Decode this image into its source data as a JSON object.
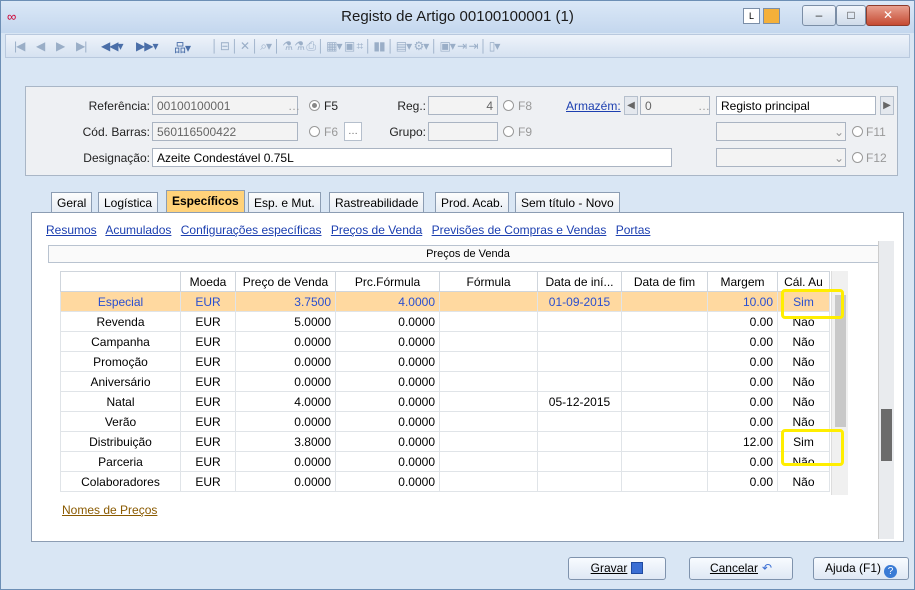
{
  "window": {
    "title": "Registo de Artigo 00100100001 (1)"
  },
  "header": {
    "referencia_label": "Referência:",
    "referencia_value": "00100100001",
    "f5": "F5",
    "reg_label": "Reg.:",
    "reg_value": "4",
    "f8": "F8",
    "armazem_label": "Armazém:",
    "armazem_value": "0",
    "armazem_desc": "Registo principal",
    "codbarras_label": "Cód. Barras:",
    "codbarras_value": "560116500422",
    "f6": "F6",
    "grupo_label": "Grupo:",
    "f9": "F9",
    "f11": "F11",
    "designacao_label": "Designação:",
    "designacao_value": "Azeite Condestável 0.75L",
    "f12": "F12"
  },
  "tabs": [
    "Geral",
    "Logística",
    "Específicos",
    "Esp. e Mut.",
    "Rastreabilidade",
    "Prod. Acab.",
    "Sem título - Novo"
  ],
  "sublinks": [
    "Resumos",
    "Acumulados",
    "Configurações específicas",
    "Preços de Venda",
    "Previsões de Compras e Vendas",
    "Portas"
  ],
  "section_title": "Preços de Venda",
  "table": {
    "columns": [
      "",
      "Moeda",
      "Preço de Venda",
      "Prc.Fórmula",
      "Fórmula",
      "Data de iní...",
      "Data de fim",
      "Margem",
      "Cál. Au"
    ],
    "rows": [
      [
        "Especial",
        "EUR",
        "3.7500",
        "4.0000",
        "",
        "01-09-2015",
        "",
        "10.00",
        "Sim"
      ],
      [
        "Revenda",
        "EUR",
        "5.0000",
        "0.0000",
        "",
        "",
        "",
        "0.00",
        "Não"
      ],
      [
        "Campanha",
        "EUR",
        "0.0000",
        "0.0000",
        "",
        "",
        "",
        "0.00",
        "Não"
      ],
      [
        "Promoção",
        "EUR",
        "0.0000",
        "0.0000",
        "",
        "",
        "",
        "0.00",
        "Não"
      ],
      [
        "Aniversário",
        "EUR",
        "0.0000",
        "0.0000",
        "",
        "",
        "",
        "0.00",
        "Não"
      ],
      [
        "Natal",
        "EUR",
        "4.0000",
        "0.0000",
        "",
        "05-12-2015",
        "",
        "0.00",
        "Não"
      ],
      [
        "Verão",
        "EUR",
        "0.0000",
        "0.0000",
        "",
        "",
        "",
        "0.00",
        "Não"
      ],
      [
        "Distribuição",
        "EUR",
        "3.8000",
        "0.0000",
        "",
        "",
        "",
        "12.00",
        "Sim"
      ],
      [
        "Parceria",
        "EUR",
        "0.0000",
        "0.0000",
        "",
        "",
        "",
        "0.00",
        "Não"
      ],
      [
        "Colaboradores",
        "EUR",
        "0.0000",
        "0.0000",
        "",
        "",
        "",
        "0.00",
        "Não"
      ]
    ]
  },
  "names_link": "Nomes de Preços",
  "footer": {
    "gravar": "Gravar",
    "cancelar": "Cancelar",
    "ajuda": "Ajuda (F1)"
  }
}
